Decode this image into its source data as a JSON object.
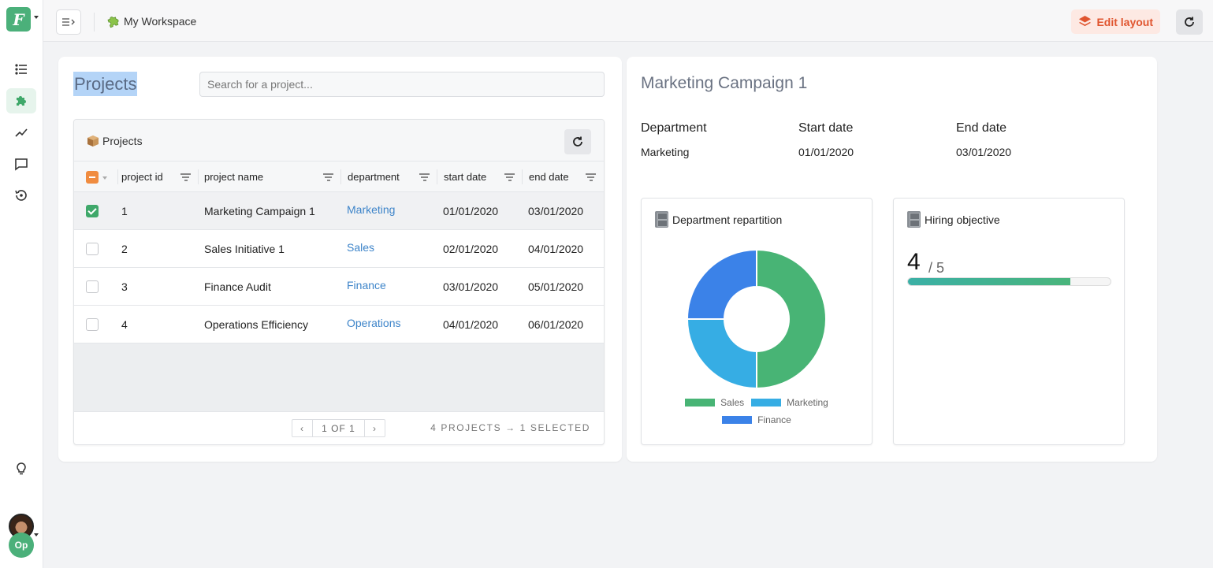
{
  "app": {
    "logo_letter": "F",
    "workspace_name": "My Workspace",
    "edit_layout_label": "Edit layout",
    "avatar_initials": "Op"
  },
  "sidebar": {
    "items": [
      {
        "name": "list",
        "icon": "list-icon",
        "active": false
      },
      {
        "name": "workspaces",
        "icon": "puzzle-icon",
        "active": true
      },
      {
        "name": "analytics",
        "icon": "trend-icon",
        "active": false
      },
      {
        "name": "messages",
        "icon": "chat-icon",
        "active": false
      },
      {
        "name": "history",
        "icon": "history-icon",
        "active": false
      }
    ],
    "bottom": [
      {
        "name": "tips",
        "icon": "lightbulb-icon"
      }
    ]
  },
  "projects": {
    "title": "Projects",
    "search_placeholder": "Search for a project...",
    "search_value": "",
    "table_title": "Projects",
    "columns": [
      "project id",
      "project name",
      "department",
      "start date",
      "end date"
    ],
    "rows": [
      {
        "id": "1",
        "name": "Marketing Campaign 1",
        "department": "Marketing",
        "start": "01/01/2020",
        "end": "03/01/2020",
        "selected": true
      },
      {
        "id": "2",
        "name": "Sales Initiative 1",
        "department": "Sales",
        "start": "02/01/2020",
        "end": "04/01/2020",
        "selected": false
      },
      {
        "id": "3",
        "name": "Finance Audit",
        "department": "Finance",
        "start": "03/01/2020",
        "end": "05/01/2020",
        "selected": false
      },
      {
        "id": "4",
        "name": "Operations Efficiency",
        "department": "Operations",
        "start": "04/01/2020",
        "end": "06/01/2020",
        "selected": false
      }
    ],
    "pager_label": "1 OF 1",
    "count_label": "4 PROJECTS → 1 SELECTED"
  },
  "detail": {
    "title": "Marketing Campaign 1",
    "fields": [
      {
        "label": "Department",
        "value": "Marketing",
        "link": true
      },
      {
        "label": "Start date",
        "value": "01/01/2020",
        "link": false
      },
      {
        "label": "End date",
        "value": "03/01/2020",
        "link": false
      }
    ],
    "repartition_title": "Department repartition",
    "hiring_title": "Hiring objective",
    "hiring_current": "4",
    "hiring_of": "/ 5",
    "hiring_progress": 0.8
  },
  "chart_data": {
    "type": "pie",
    "subtype": "donut",
    "title": "Department repartition",
    "categories": [
      "Sales",
      "Marketing",
      "Finance"
    ],
    "values": [
      50,
      25,
      25
    ],
    "colors": [
      "#48b475",
      "#36ade4",
      "#3b82e8"
    ],
    "legend": "bottom"
  }
}
